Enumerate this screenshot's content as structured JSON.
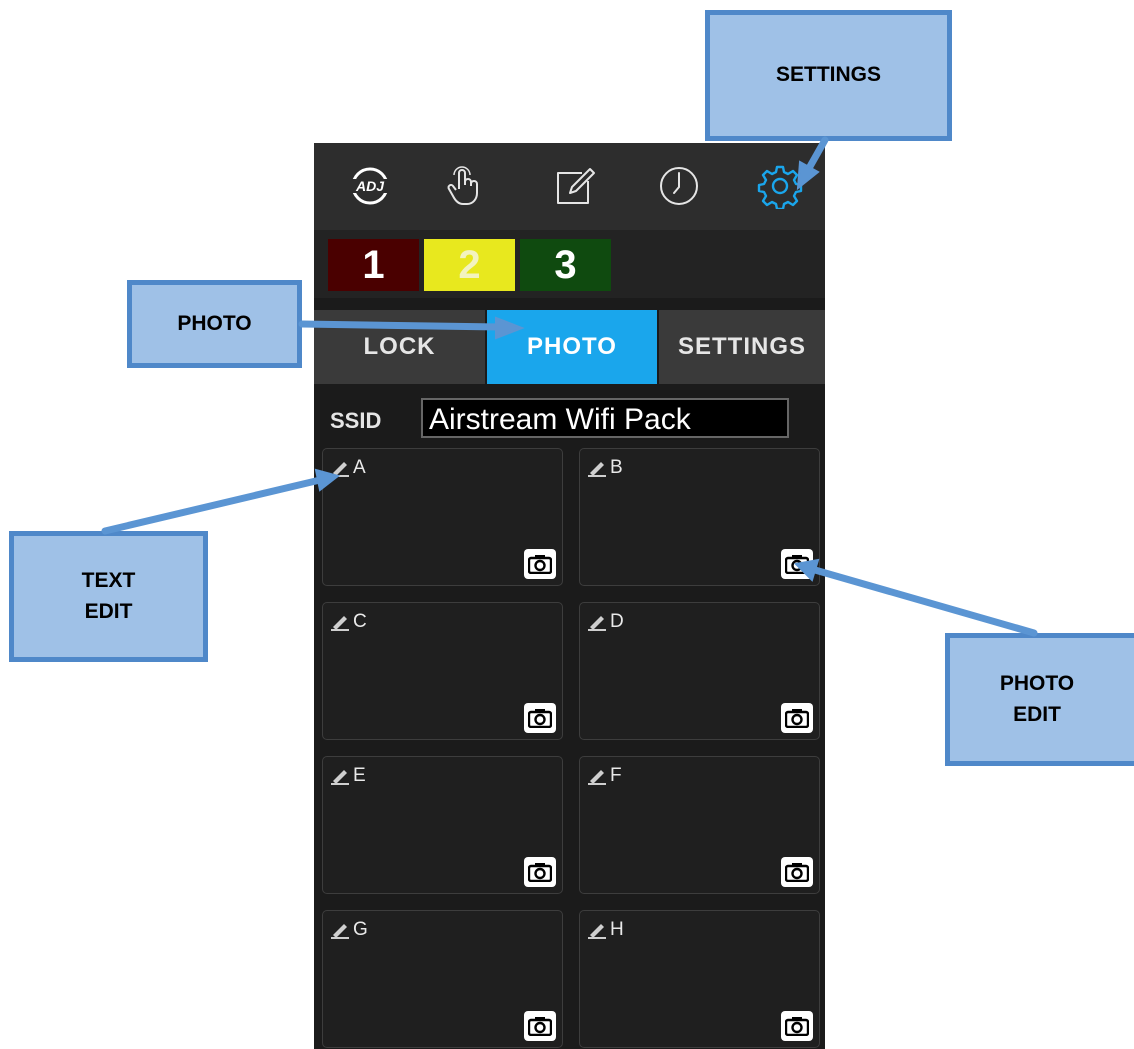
{
  "topbar": {
    "icons": [
      "adj-logo-icon",
      "touch-hand-icon",
      "edit-note-icon",
      "clock-icon",
      "settings-gear-icon"
    ],
    "active_icon": "settings-gear-icon",
    "accent_color": "#1aa6ec"
  },
  "presets": [
    {
      "label": "1",
      "color": "#4a0000"
    },
    {
      "label": "2",
      "color": "#e8e81e"
    },
    {
      "label": "3",
      "color": "#0f4a0f"
    }
  ],
  "tabs": [
    {
      "label": "LOCK",
      "active": false
    },
    {
      "label": "PHOTO",
      "active": true
    },
    {
      "label": "SETTINGS",
      "active": false
    }
  ],
  "ssid": {
    "label": "SSID",
    "value": "Airstream Wifi Pack"
  },
  "tiles": [
    {
      "label": "A"
    },
    {
      "label": "B"
    },
    {
      "label": "C"
    },
    {
      "label": "D"
    },
    {
      "label": "E"
    },
    {
      "label": "F"
    },
    {
      "label": "G"
    },
    {
      "label": "H"
    }
  ],
  "callouts": {
    "settings": "SETTINGS",
    "photo": "PHOTO",
    "text_edit_line1": "TEXT",
    "text_edit_line2": "EDIT",
    "photo_edit_line1": "PHOTO",
    "photo_edit_line2": "EDIT"
  }
}
